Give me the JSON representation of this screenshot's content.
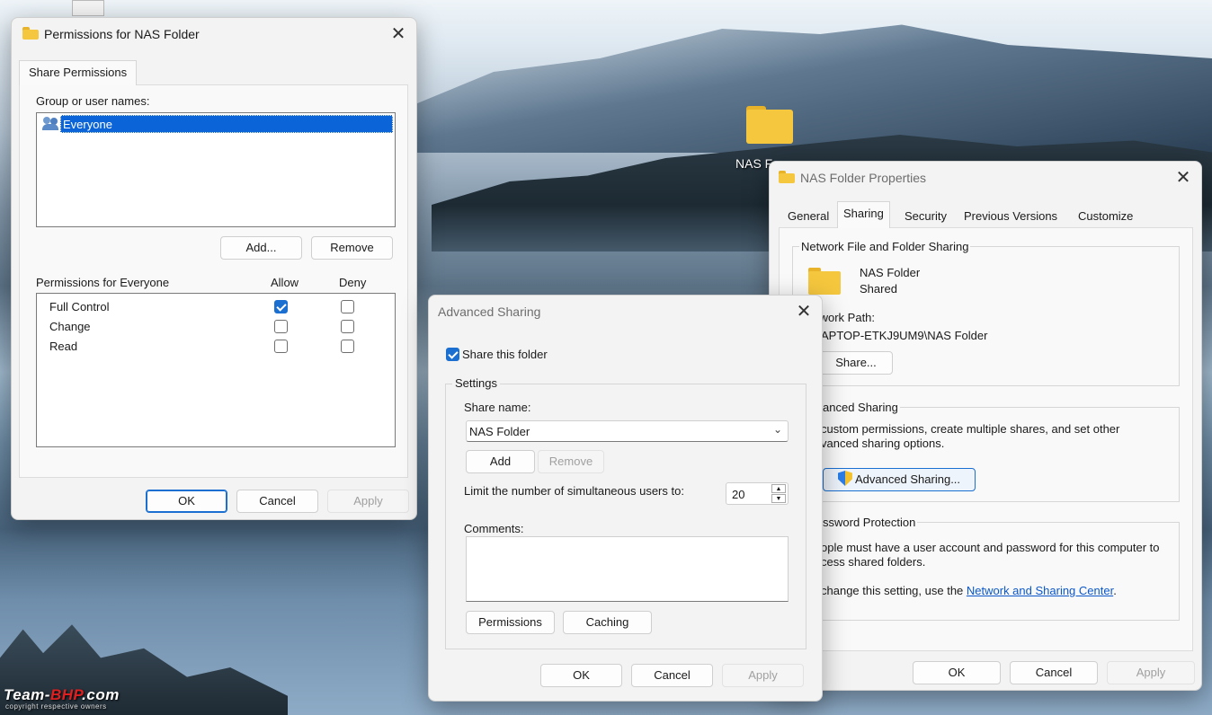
{
  "desktop": {
    "icon_label": "NAS F",
    "watermark": {
      "brand_a": "Team-",
      "brand_b": "BHP",
      "brand_c": ".com",
      "copyright": "copyright respective owners"
    }
  },
  "permissions_dialog": {
    "title": "Permissions for NAS Folder",
    "tab": "Share Permissions",
    "group_label": "Group or user names:",
    "users": [
      "Everyone"
    ],
    "add_button": "Add...",
    "remove_button": "Remove",
    "perm_header": "Permissions for Everyone",
    "allow_header": "Allow",
    "deny_header": "Deny",
    "permissions": [
      {
        "name": "Full Control",
        "allow": true,
        "deny": false
      },
      {
        "name": "Change",
        "allow": false,
        "deny": false
      },
      {
        "name": "Read",
        "allow": false,
        "deny": false
      }
    ],
    "ok": "OK",
    "cancel": "Cancel",
    "apply": "Apply"
  },
  "advanced_sharing": {
    "title": "Advanced Sharing",
    "share_checkbox": "Share this folder",
    "share_checked": true,
    "settings_label": "Settings",
    "share_name_label": "Share name:",
    "share_name_value": "NAS Folder",
    "add_button": "Add",
    "remove_button": "Remove",
    "limit_label": "Limit the number of simultaneous users to:",
    "limit_value": "20",
    "comments_label": "Comments:",
    "comments_value": "",
    "permissions_button": "Permissions",
    "caching_button": "Caching",
    "ok": "OK",
    "cancel": "Cancel",
    "apply": "Apply"
  },
  "properties": {
    "title": "NAS Folder Properties",
    "tabs": [
      "General",
      "Sharing",
      "Security",
      "Previous Versions",
      "Customize"
    ],
    "active_tab": "Sharing",
    "net_sharing_label": "Network File and Folder Sharing",
    "folder_name": "NAS Folder",
    "folder_status": "Shared",
    "network_path_label": "twork Path:",
    "network_path": "APTOP-ETKJ9UM9\\NAS Folder",
    "share_button": "Share...",
    "adv_label": "anced Sharing",
    "adv_text_1": " custom permissions, create multiple shares, and set other",
    "adv_text_2": "vanced sharing options.",
    "adv_button": "Advanced Sharing...",
    "pw_label": "ssword Protection",
    "pw_text_1": "ople must have a user account and password for this computer to",
    "pw_text_2": "cess shared folders.",
    "pw_text_3": " change this setting, use the ",
    "pw_link": "Network and Sharing Center",
    "pw_text_4": ".",
    "ok": "OK",
    "cancel": "Cancel",
    "apply": "Apply"
  }
}
